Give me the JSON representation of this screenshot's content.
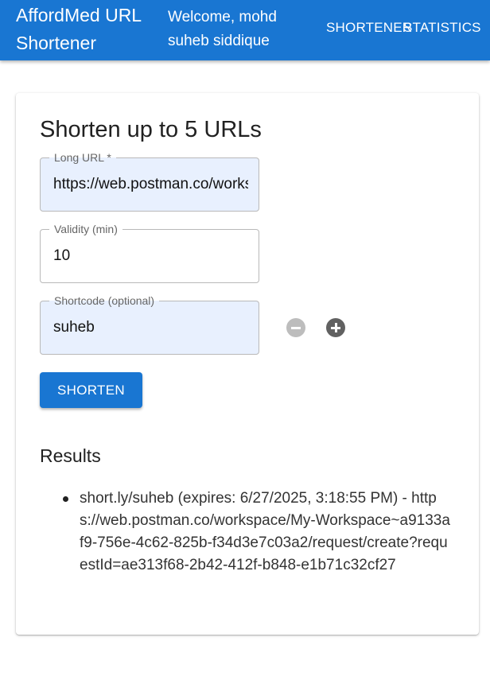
{
  "header": {
    "brand": "AffordMed URL Shortener",
    "welcome": "Welcome, mohd suheb siddique",
    "nav": [
      "SHORTENER",
      "STATISTICS"
    ]
  },
  "form": {
    "title": "Shorten up to 5 URLs",
    "long_url": {
      "label": "Long URL *",
      "value": "https://web.postman.co/workspace/My-Workspace~a9133af9-756e-4c62-825b-f34d3e7c03a2/request/create?requestId=ae313f68-2b42-412f-b848-e1b71c32cf27"
    },
    "validity": {
      "label": "Validity (min)",
      "value": "10"
    },
    "shortcode": {
      "label": "Shortcode (optional)",
      "value": "suheb"
    },
    "submit_label": "SHORTEN",
    "icons": {
      "remove": "remove-circle-icon",
      "add": "add-circle-icon"
    }
  },
  "results": {
    "heading": "Results",
    "items": [
      "short.ly/suheb (expires: 6/27/2025, 3:18:55 PM) - https://web.postman.co/workspace/My-Workspace~a9133af9-756e-4c62-825b-f34d3e7c03a2/request/create?requestId=ae313f68-2b42-412f-b848-e1b71c32cf27"
    ]
  },
  "colors": {
    "primary": "#1976d2",
    "autofill_bg": "#e8f0fe",
    "icon_disabled": "#bdbdbd",
    "icon_active": "#616161"
  }
}
